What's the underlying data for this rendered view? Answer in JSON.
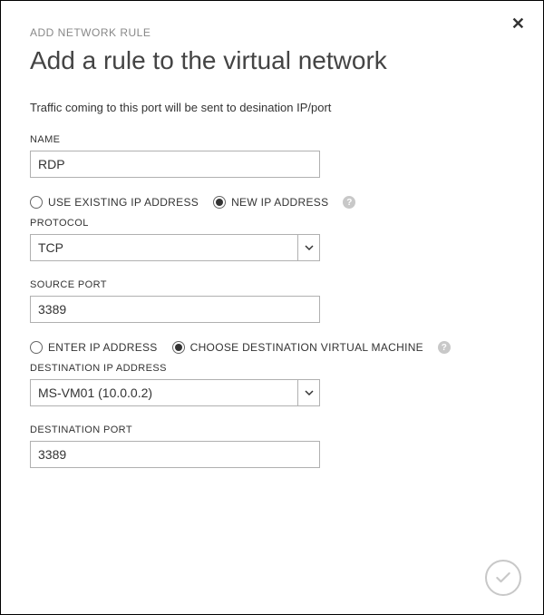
{
  "breadcrumb": "ADD NETWORK RULE",
  "title": "Add a rule to the virtual network",
  "description": "Traffic coming to this port will be sent to desination IP/port",
  "fields": {
    "name": {
      "label": "NAME",
      "value": "RDP"
    },
    "protocol": {
      "label": "PROTOCOL",
      "value": "TCP"
    },
    "sourcePort": {
      "label": "SOURCE PORT",
      "value": "3389"
    },
    "destinationIp": {
      "label": "DESTINATION IP ADDRESS",
      "value": "MS-VM01 (10.0.0.2)"
    },
    "destinationPort": {
      "label": "DESTINATION PORT",
      "value": "3389"
    }
  },
  "radios": {
    "ipMode": {
      "options": [
        {
          "label": "USE EXISTING IP ADDRESS",
          "checked": false
        },
        {
          "label": "NEW IP ADDRESS",
          "checked": true
        }
      ]
    },
    "destMode": {
      "options": [
        {
          "label": "ENTER IP ADDRESS",
          "checked": false
        },
        {
          "label": "CHOOSE DESTINATION VIRTUAL MACHINE",
          "checked": true
        }
      ]
    }
  },
  "helpGlyph": "?"
}
